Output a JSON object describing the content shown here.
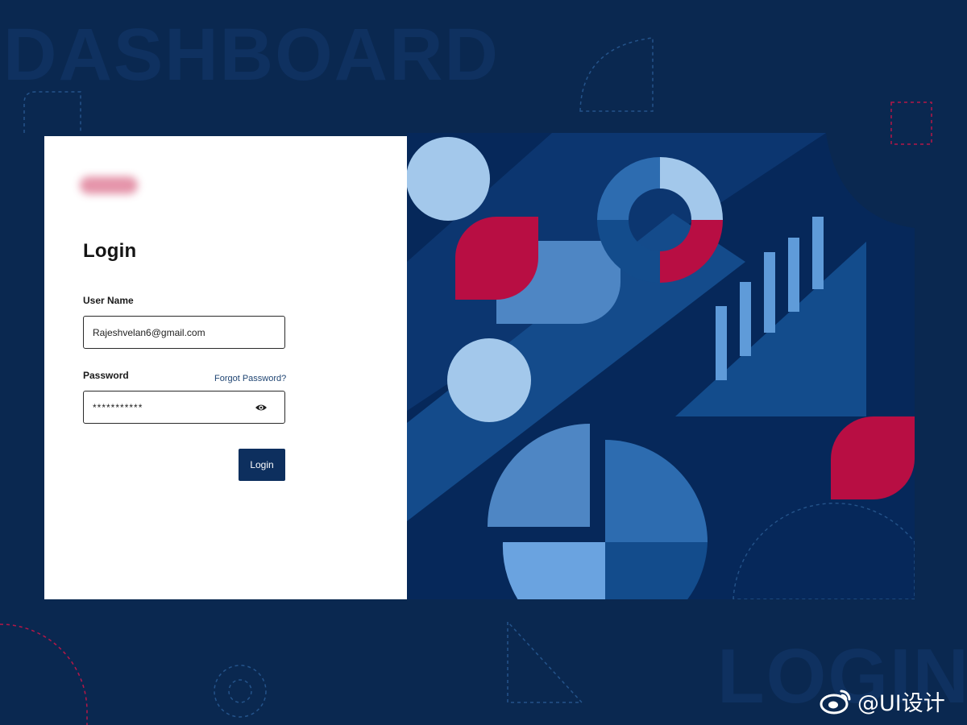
{
  "background": {
    "word_top": "DASHBOARD",
    "word_bottom": "LOGIN"
  },
  "login_form": {
    "title": "Login",
    "username": {
      "label": "User Name",
      "value": "Rajeshvelan6@gmail.com"
    },
    "password": {
      "label": "Password",
      "value": "***********",
      "forgot_link": "Forgot Password?",
      "toggle_icon": "eye-icon"
    },
    "submit_label": "Login"
  },
  "watermark": {
    "text": "@UI设计",
    "icon": "weibo-icon"
  },
  "colors": {
    "background": "#0a2850",
    "panel_navy": "#06285a",
    "primary_button": "#0d2f5e",
    "accent_red": "#b80e43",
    "light_blue": "#a3c8eb",
    "mid_blue": "#4e86c4",
    "deep_blue": "#134c8c"
  }
}
